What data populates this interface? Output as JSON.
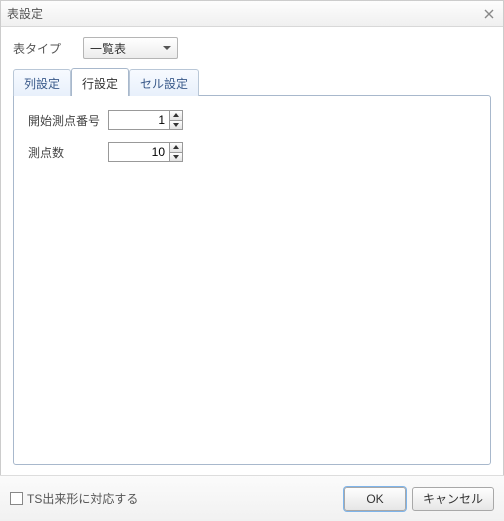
{
  "window": {
    "title": "表設定"
  },
  "table_type": {
    "label": "表タイプ",
    "value": "一覧表"
  },
  "tabs": [
    {
      "label": "列設定"
    },
    {
      "label": "行設定"
    },
    {
      "label": "セル設定"
    }
  ],
  "active_tab": 1,
  "row_settings": {
    "start_point": {
      "label": "開始測点番号",
      "value": "1"
    },
    "point_count": {
      "label": "測点数",
      "value": "10"
    }
  },
  "footer": {
    "ts_checkbox": "TS出来形に対応する",
    "ok": "OK",
    "cancel": "キャンセル"
  }
}
